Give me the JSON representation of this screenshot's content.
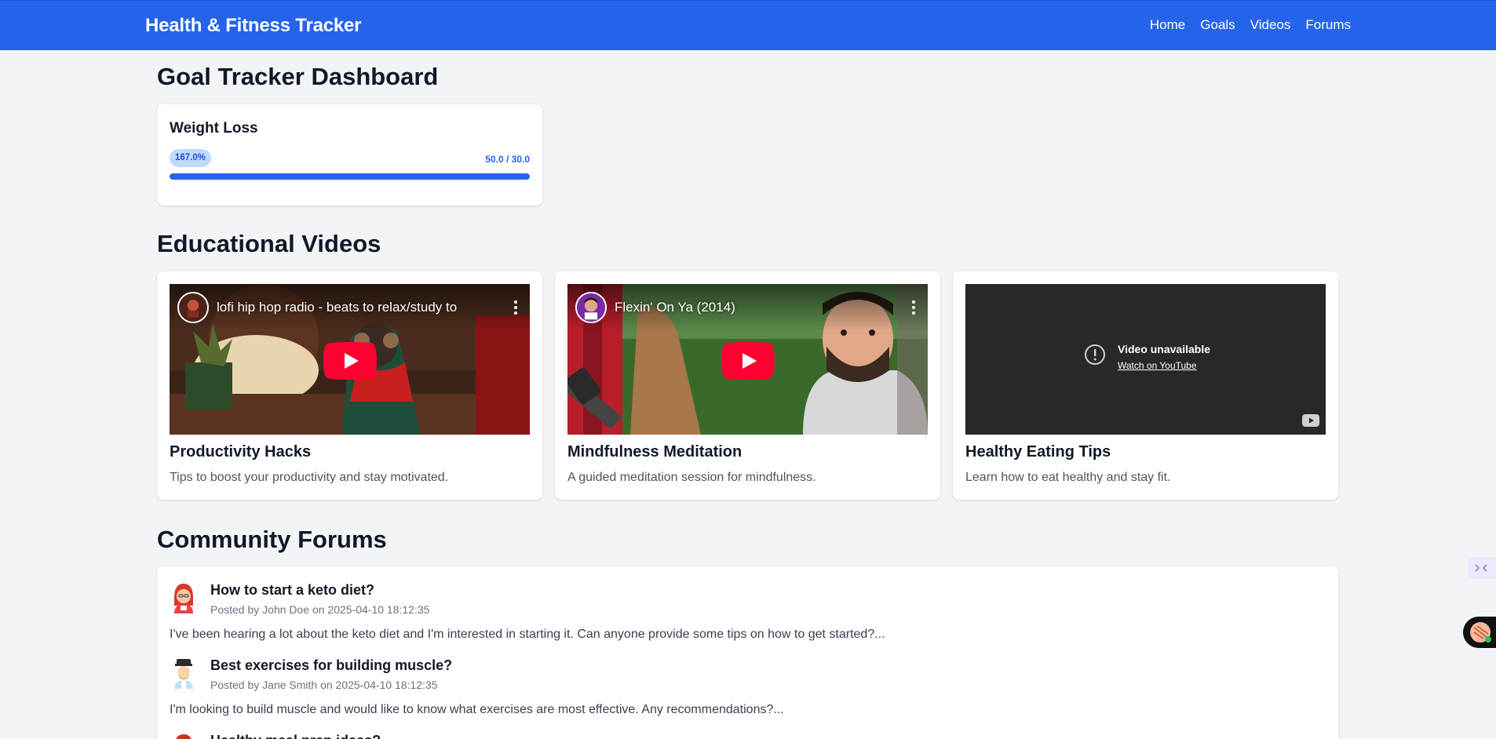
{
  "app": {
    "title": "Health & Fitness Tracker"
  },
  "nav": {
    "items": [
      "Home",
      "Goals",
      "Videos",
      "Forums"
    ]
  },
  "goals": {
    "heading": "Goal Tracker Dashboard",
    "items": [
      {
        "title": "Weight Loss",
        "percent_label": "167.0%",
        "ratio": "50.0 / 30.0",
        "progress_fraction": 1.0
      }
    ]
  },
  "videos": {
    "heading": "Educational Videos",
    "items": [
      {
        "title": "Productivity Hacks",
        "description": "Tips to boost your productivity and stay motivated.",
        "embed_caption": "lofi hip hop radio - beats to relax/study to"
      },
      {
        "title": "Mindfulness Meditation",
        "description": "A guided meditation session for mindfulness.",
        "embed_caption": "Flexin' On Ya (2014)"
      },
      {
        "title": "Healthy Eating Tips",
        "description": "Learn how to eat healthy and stay fit.",
        "unavailable_title": "Video unavailable",
        "unavailable_link": "Watch on YouTube"
      }
    ]
  },
  "forums": {
    "heading": "Community Forums",
    "posts": [
      {
        "title": "How to start a keto diet?",
        "meta": "Posted by John Doe on 2025-04-10 18:12:35",
        "body": "I've been hearing a lot about the keto diet and I'm interested in starting it. Can anyone provide some tips on how to get started?..."
      },
      {
        "title": "Best exercises for building muscle?",
        "meta": "Posted by Jane Smith on 2025-04-10 18:12:35",
        "body": "I'm looking to build muscle and would like to know what exercises are most effective. Any recommendations?..."
      },
      {
        "title": "Healthy meal prep ideas?",
        "meta": "",
        "body": ""
      }
    ]
  },
  "colors": {
    "primary": "#2563eb",
    "badge_bg": "#bfdbfe",
    "background": "#f3f4f6",
    "youtube_red": "#ff0033"
  }
}
